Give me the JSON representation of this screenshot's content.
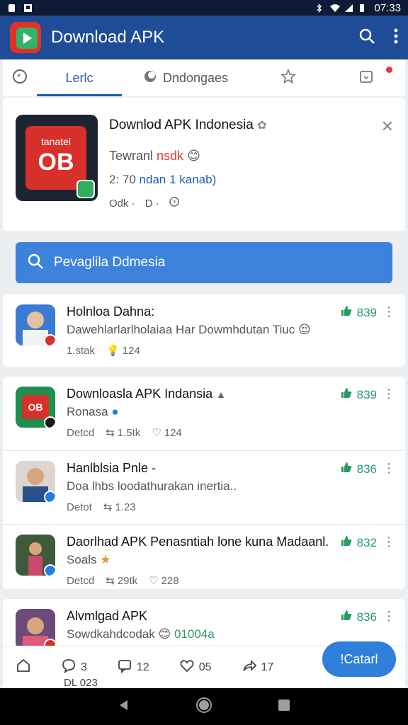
{
  "status_bar": {
    "time": "07:33"
  },
  "app_bar": {
    "title": "Download APK"
  },
  "tabs": [
    {
      "label": ""
    },
    {
      "label": "Lerlc"
    },
    {
      "label": "Dndongaes"
    },
    {
      "label": ""
    },
    {
      "label": ""
    }
  ],
  "app_card": {
    "name": "Downlod APK Indonesia",
    "icon_text_top": "tanatel",
    "icon_text_main": "OB",
    "developer_prefix": "Tewranl ",
    "developer_highlight": "nsdk",
    "downloads_prefix": "2: 70 ",
    "downloads_link": "ndan 1 kanab",
    "meta_a": "Odk",
    "meta_b": "D"
  },
  "search": {
    "label": "Pevaglila Ddmesia"
  },
  "posts": [
    {
      "title": "Holnloa Dahna:",
      "subtitle": "Dawehlarlarlholaiaa Har Dowmhdutan Tiuc",
      "meta_left": "1.stak",
      "meta_right": "124",
      "likes": "839"
    }
  ],
  "feed": [
    {
      "title": "Downloasla APK Indansia",
      "subtitle": "Ronasa",
      "meta": [
        "Detcd",
        "1.5tk",
        "124"
      ],
      "likes": "839",
      "avatar_text": "OB"
    },
    {
      "title": "Hanlblsia Pnle -",
      "subtitle": "Doa lhbs loodathurakan inertia..",
      "meta": [
        "Detot",
        "1.23"
      ],
      "likes": "836"
    },
    {
      "title": "Daorlhad APK Penasntiah lone kuna Madaanl.",
      "subtitle": "Soals",
      "meta": [
        "Detcd",
        "29tk",
        "228"
      ],
      "likes": "832"
    }
  ],
  "last_post": {
    "title": "Alvmlgad APK",
    "subtitle_prefix": "Sowdkahdcodak ",
    "subtitle_tail": "01004a",
    "likes": "836"
  },
  "bottom_bar": {
    "comments": "3",
    "replies": "12",
    "favorites": "05",
    "shares": "17",
    "action_label": "!Catarl"
  },
  "footnote": "DL 023",
  "colors": {
    "accent": "#1f4c96",
    "search_bg": "#3d82db",
    "like_green": "#2a9b63"
  }
}
